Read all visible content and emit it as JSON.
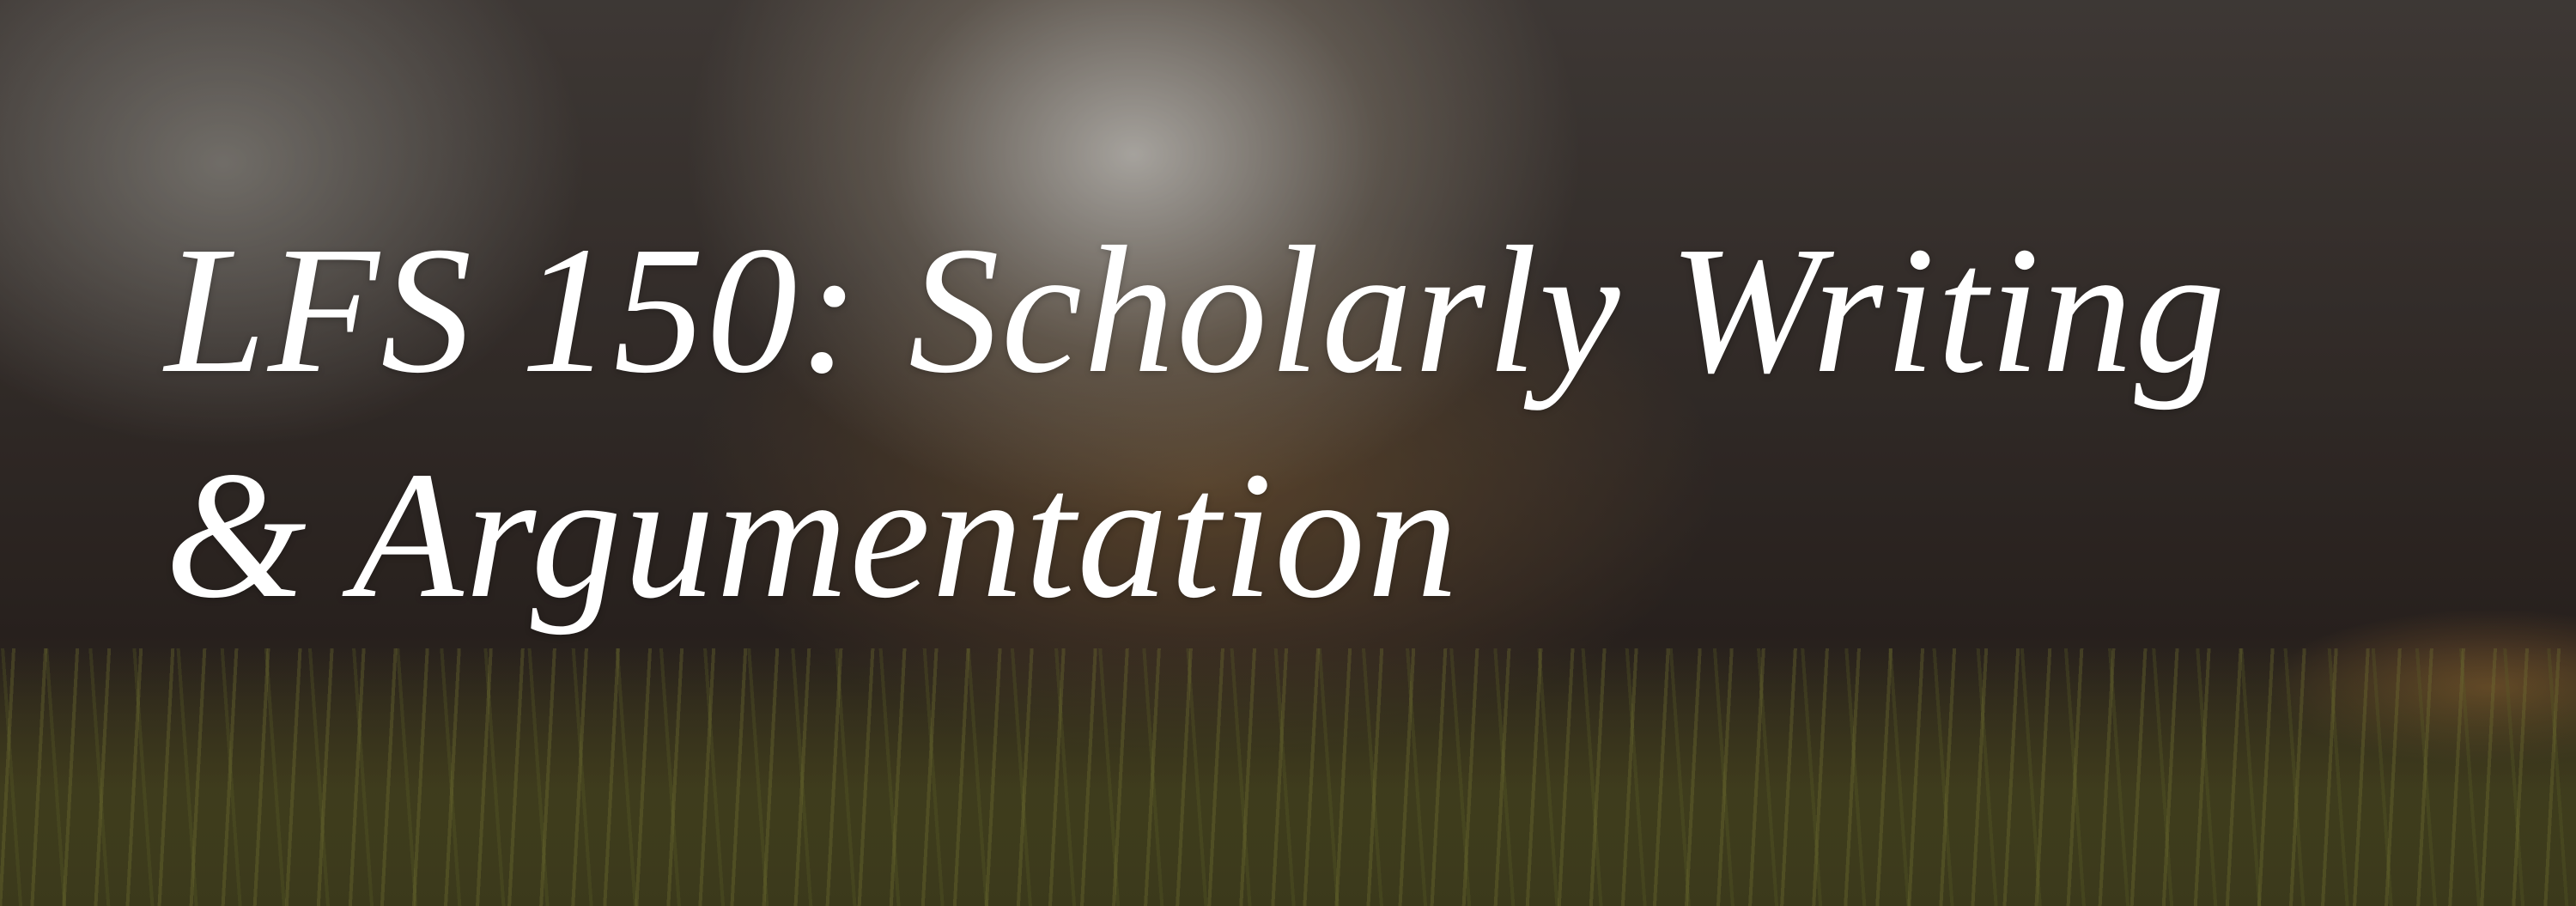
{
  "banner": {
    "title_line1": "LFS 150: Scholarly Writing",
    "title_line2": "& Argumentation"
  }
}
